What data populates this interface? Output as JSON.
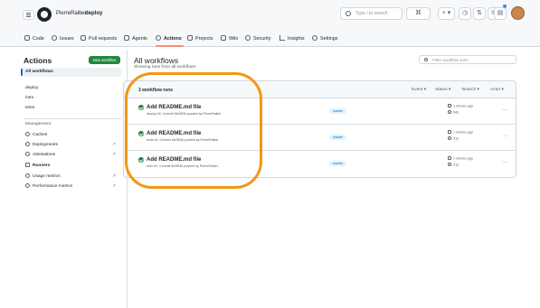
{
  "header": {
    "owner": "PierreRaitier",
    "separator": "/",
    "repo": "deploy",
    "search_placeholder": "Type / to search",
    "buttons": [
      "⌘",
      "+ ▾",
      "◷",
      "⇅",
      "✉",
      "▤"
    ]
  },
  "tabs": [
    {
      "label": "Code"
    },
    {
      "label": "Issues"
    },
    {
      "label": "Pull requests"
    },
    {
      "label": "Agents"
    },
    {
      "label": "Actions"
    },
    {
      "label": "Projects"
    },
    {
      "label": "Wiki"
    },
    {
      "label": "Security"
    },
    {
      "label": "Insights"
    },
    {
      "label": "Settings"
    }
  ],
  "sidebar": {
    "title": "Actions",
    "new_workflow": "New workflow",
    "all_workflows": "All workflows",
    "workflows": [
      "deploy",
      "intro",
      "tests"
    ],
    "management_label": "Management",
    "management": [
      {
        "label": "Caches",
        "arrow": ""
      },
      {
        "label": "Deployments",
        "arrow": "↗"
      },
      {
        "label": "Attestations",
        "arrow": "↗"
      },
      {
        "label": "Runners",
        "arrow": ""
      },
      {
        "label": "Usage metrics",
        "arrow": "↗"
      },
      {
        "label": "Performance metrics",
        "arrow": "↗"
      }
    ]
  },
  "main": {
    "title": "All workflows",
    "subtitle": "Showing runs from all workflows",
    "filter_placeholder": "Filter workflow runs",
    "runs_count": "3 workflow runs",
    "filters": [
      "Event ▾",
      "Status ▾",
      "Branch ▾",
      "Actor ▾"
    ],
    "runs": [
      {
        "title": "Add README.md file",
        "meta": "deploy #4: Commit 6b2f53b pushed by PierreRaitier",
        "branch": "master",
        "time": "1 minute ago",
        "duration": "54s"
      },
      {
        "title": "Add README.md file",
        "meta": "tests #4: Commit 6b2f53b pushed by PierreRaitier",
        "branch": "master",
        "time": "1 minute ago",
        "duration": "31s"
      },
      {
        "title": "Add README.md file",
        "meta": "intro #4: Commit 6b2f53b pushed by PierreRaitier",
        "branch": "master",
        "time": "1 minute ago",
        "duration": "21s"
      }
    ],
    "kebab": "···"
  },
  "colors": {
    "success": "#1a7f37",
    "accent": "#0969da",
    "active_tab": "#fd8c73",
    "annotation": "#f29614",
    "new_workflow_bg": "#1f883d"
  }
}
